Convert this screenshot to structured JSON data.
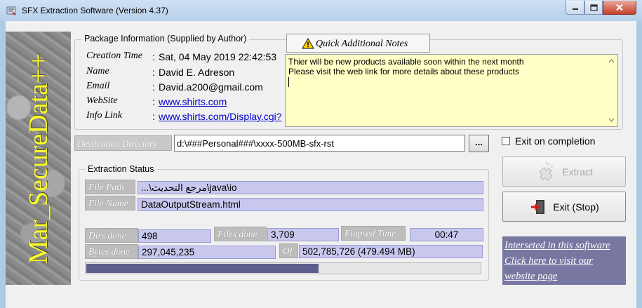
{
  "window": {
    "title": "SFX Extraction Software (Version 4.37)",
    "icons": {
      "app": "sfx-app-icon",
      "minimize": "minimize-icon",
      "maximize": "maximize-icon",
      "close": "close-icon"
    }
  },
  "sidebar": {
    "brand_text": "Mar_SecureData++",
    "text_color": "#ffff2a"
  },
  "package_info": {
    "group_title": "Package Information  (Supplied by Author)",
    "fields": [
      {
        "label": "Creation Time",
        "value": "Sat, 04 May 2019 22:42:53",
        "is_link": false
      },
      {
        "label": "Name",
        "value": "David E. Adreson",
        "is_link": false
      },
      {
        "label": "Email",
        "value": "David.a200@gmail.com",
        "is_link": false
      },
      {
        "label": "WebSite",
        "value": "www.shirts.com",
        "is_link": true
      },
      {
        "label": "Info Link",
        "value": "www.shirts.com/Display.cgi?",
        "is_link": true
      }
    ],
    "separator": ":"
  },
  "notes": {
    "tab_label": "Quick Additional Notes",
    "tab_icon": "warning-icon",
    "lines": [
      "Thier will be new products available soon within the next month",
      "Please visit the web link for more details about these products"
    ],
    "background": "#ffffc6"
  },
  "destination": {
    "label": "Destination Directory",
    "value": "d:\\###Personal###\\xxxx-500MB-sfx-rst",
    "browse_label": "..."
  },
  "exit_on_completion": {
    "label": "Exit on completion",
    "checked": false
  },
  "extraction_status": {
    "group_title": "Extraction Status",
    "file_path_label": "File Path",
    "file_path_value": "...\\مرجع التحديث\\java\\io",
    "file_name_label": "File Name",
    "file_name_value": "DataOutputStream.html",
    "dirs_done_label": "Dirs  done",
    "dirs_done_value": "498",
    "files_done_label": "Files done",
    "files_done_value": "3,709",
    "elapsed_label": "Elapsed Time",
    "elapsed_value": "00:47",
    "bytes_done_label": "Bytes done",
    "bytes_done_value": "297,045,235",
    "of_label": "Of",
    "of_value": "502,785,726 (479.494 MB)",
    "progress_fraction": 0.59,
    "progress_color": "#5f5f8e"
  },
  "buttons": {
    "extract_label": "Extract",
    "extract_icon": "extract-puzzle-icon",
    "exit_label": "Exit (Stop)",
    "exit_icon": "exit-door-icon"
  },
  "promo": {
    "lines": [
      "Interseted in this software",
      "Click here to visit our",
      "website page"
    ],
    "background": "#7777a1"
  }
}
